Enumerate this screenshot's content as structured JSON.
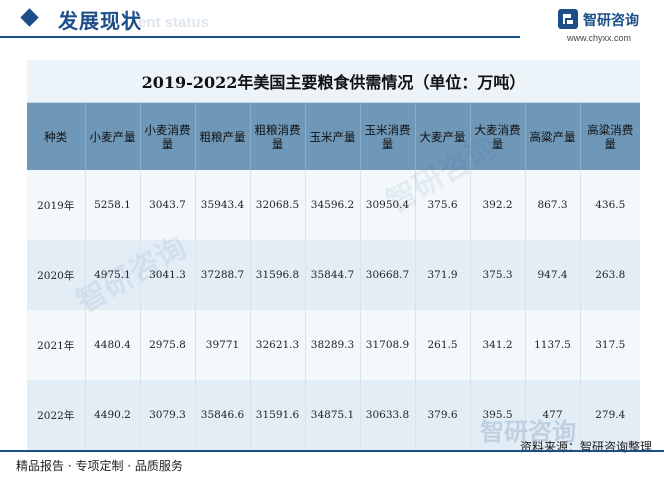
{
  "header": {
    "title": "发展现状",
    "title_ghost": "ent status",
    "logo_name": "智研咨询",
    "logo_url": "www.chyxx.com"
  },
  "watermark": {
    "text": "智研咨询",
    "footer_text": "智研咨询"
  },
  "chart_data": {
    "type": "table",
    "title": "2019-2022年美国主要粮食供需情况（单位：万吨）",
    "columns": [
      "种类",
      "小麦产量",
      "小麦消费量",
      "粗粮产量",
      "粗粮消费量",
      "玉米产量",
      "玉米消费量",
      "大麦产量",
      "大麦消费量",
      "高粱产量",
      "高粱消费量"
    ],
    "rows": [
      [
        "2019年",
        "5258.1",
        "3043.7",
        "35943.4",
        "32068.5",
        "34596.2",
        "30950.4",
        "375.6",
        "392.2",
        "867.3",
        "436.5"
      ],
      [
        "2020年",
        "4975.1",
        "3041.3",
        "37288.7",
        "31596.8",
        "35844.7",
        "30668.7",
        "371.9",
        "375.3",
        "947.4",
        "263.8"
      ],
      [
        "2021年",
        "4480.4",
        "2975.8",
        "39771",
        "32621.3",
        "38289.3",
        "31708.9",
        "261.5",
        "341.2",
        "1137.5",
        "317.5"
      ],
      [
        "2022年",
        "4490.2",
        "3079.3",
        "35846.6",
        "31591.6",
        "34875.1",
        "30633.8",
        "379.6",
        "395.5",
        "477",
        "279.4"
      ]
    ]
  },
  "footer": {
    "left": "精品报告 · 专项定制 · 品质服务",
    "source": "资料来源：智研咨询整理"
  },
  "colors": {
    "brand": "#1c4e8a",
    "header_row": "#6f97b8",
    "row_light": "#f3f8fb",
    "row_dark": "#e3edf5"
  }
}
